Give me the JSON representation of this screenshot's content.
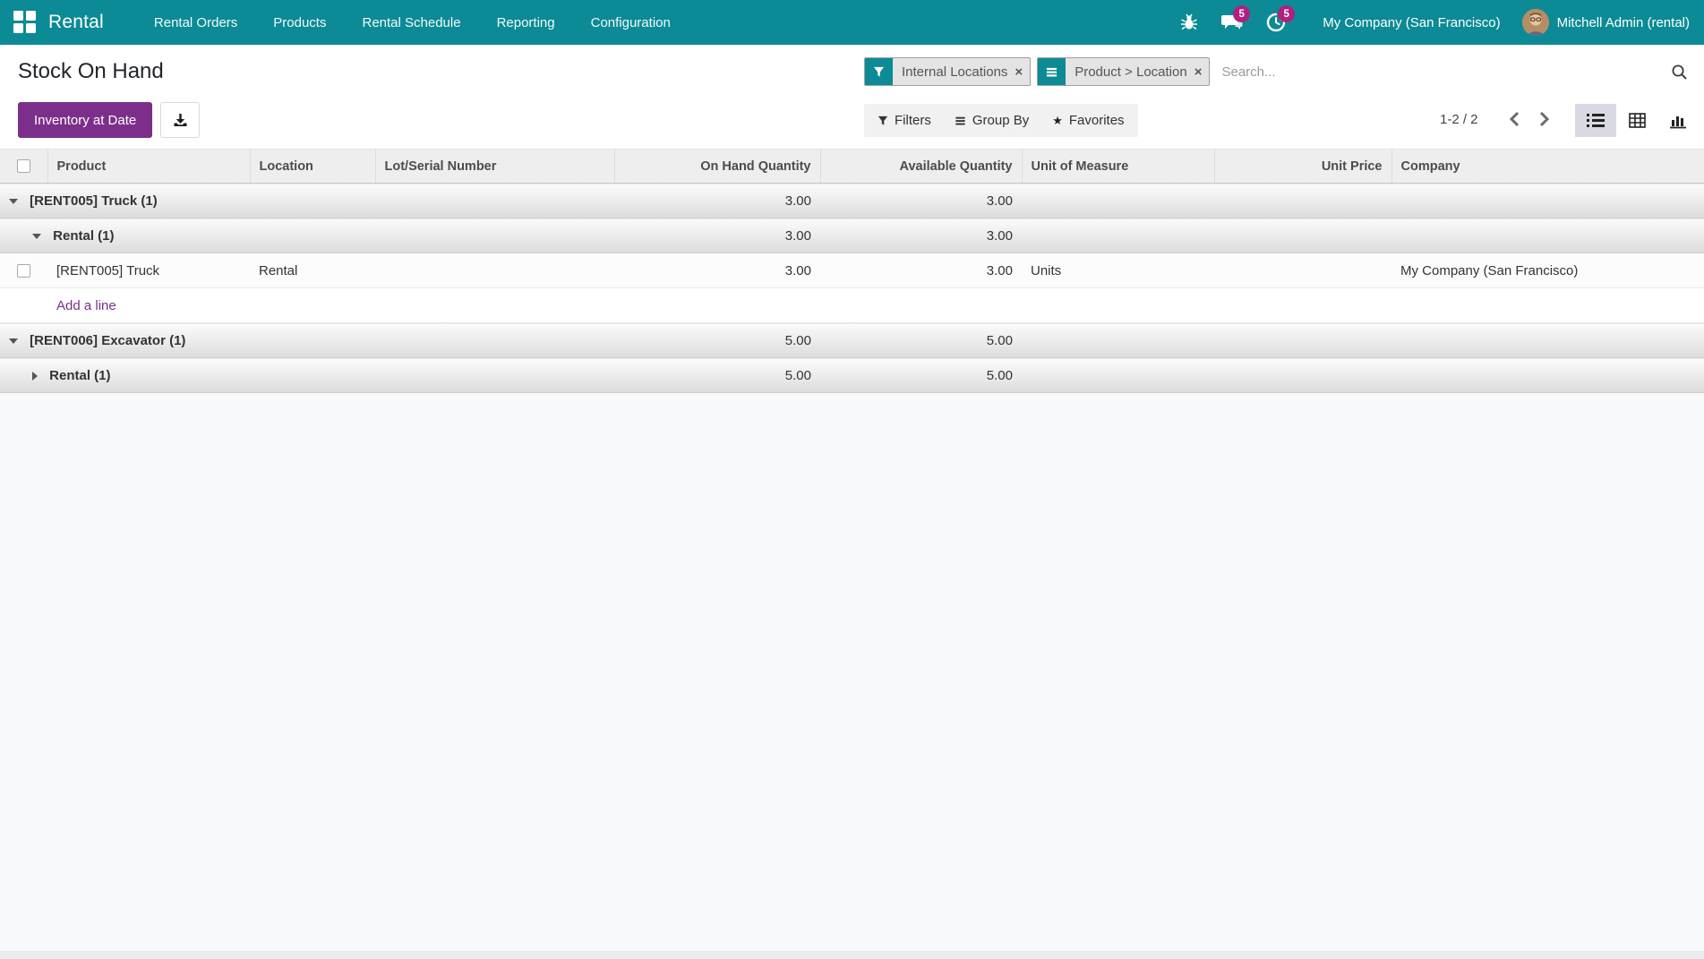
{
  "colors": {
    "brand_teal": "#0c8a96",
    "accent_purple": "#7c2f8a",
    "badge_magenta": "#ae217e"
  },
  "navbar": {
    "brand": "Rental",
    "menus": [
      {
        "label": "Rental Orders"
      },
      {
        "label": "Products"
      },
      {
        "label": "Rental Schedule"
      },
      {
        "label": "Reporting"
      },
      {
        "label": "Configuration"
      }
    ],
    "messages_badge": "5",
    "activities_badge": "5",
    "company_switcher": "My Company (San Francisco)",
    "user_name": "Mitchell Admin (rental)"
  },
  "control_panel": {
    "title": "Stock On Hand",
    "inventory_at_date_label": "Inventory at Date",
    "search": {
      "facets": [
        {
          "icon": "filter-icon",
          "label": "Internal Locations"
        },
        {
          "icon": "group-by-icon",
          "label": "Product > Location"
        }
      ],
      "remove_symbol": "×",
      "placeholder": "Search..."
    },
    "toolbar": {
      "filters": "Filters",
      "group_by": "Group By",
      "favorites": "Favorites",
      "favorites_star": "★"
    },
    "pager": {
      "text": "1-2 / 2"
    }
  },
  "table": {
    "headers": {
      "product": "Product",
      "location": "Location",
      "lot_serial": "Lot/Serial Number",
      "on_hand": "On Hand Quantity",
      "available": "Available Quantity",
      "uom": "Unit of Measure",
      "unit_price": "Unit Price",
      "company": "Company"
    },
    "rows": [
      {
        "type": "group",
        "level": 1,
        "expanded": true,
        "label": "[RENT005] Truck (1)",
        "on_hand": "3.00",
        "available": "3.00"
      },
      {
        "type": "group",
        "level": 2,
        "expanded": true,
        "label": "Rental (1)",
        "on_hand": "3.00",
        "available": "3.00"
      },
      {
        "type": "data",
        "product": "[RENT005] Truck",
        "location": "Rental",
        "lot_serial": "",
        "on_hand": "3.00",
        "available": "3.00",
        "uom": "Units",
        "unit_price": "",
        "company": "My Company (San Francisco)"
      },
      {
        "type": "add_line",
        "label": "Add a line"
      },
      {
        "type": "group",
        "level": 1,
        "expanded": true,
        "label": "[RENT006] Excavator (1)",
        "on_hand": "5.00",
        "available": "5.00"
      },
      {
        "type": "group",
        "level": 2,
        "expanded": false,
        "label": "Rental (1)",
        "on_hand": "5.00",
        "available": "5.00"
      }
    ]
  }
}
